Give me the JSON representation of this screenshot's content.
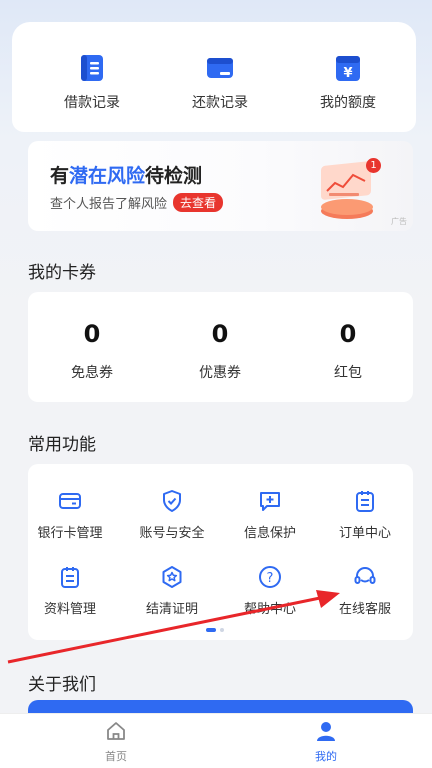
{
  "quick_actions": [
    {
      "label": "借款记录",
      "icon": "loan-record-icon"
    },
    {
      "label": "还款记录",
      "icon": "repay-record-icon"
    },
    {
      "label": "我的额度",
      "icon": "credit-limit-icon"
    }
  ],
  "promo": {
    "title_prefix": "有",
    "title_highlight": "潜在风险",
    "title_suffix": "待检测",
    "subtitle": "查个人报告了解风险",
    "button": "去查看",
    "badge": "1",
    "ad_tag": "广告"
  },
  "coupons": {
    "title": "我的卡券",
    "items": [
      {
        "value": "0",
        "label": "免息券"
      },
      {
        "value": "0",
        "label": "优惠券"
      },
      {
        "value": "0",
        "label": "红包"
      }
    ]
  },
  "functions": {
    "title": "常用功能",
    "items": [
      {
        "label": "银行卡管理",
        "icon": "bank-card-icon"
      },
      {
        "label": "账号与安全",
        "icon": "shield-check-icon"
      },
      {
        "label": "信息保护",
        "icon": "info-protect-icon"
      },
      {
        "label": "订单中心",
        "icon": "order-list-icon"
      },
      {
        "label": "资料管理",
        "icon": "document-icon"
      },
      {
        "label": "结清证明",
        "icon": "certificate-icon"
      },
      {
        "label": "帮助中心",
        "icon": "help-icon"
      },
      {
        "label": "在线客服",
        "icon": "headset-icon"
      }
    ]
  },
  "about": {
    "title": "关于我们"
  },
  "tabbar": [
    {
      "label": "首页",
      "icon": "home-icon",
      "active": false
    },
    {
      "label": "我的",
      "icon": "user-icon",
      "active": true
    }
  ],
  "colors": {
    "accent": "#2f6af2",
    "danger": "#e8352e",
    "arrow": "#e8262a"
  }
}
